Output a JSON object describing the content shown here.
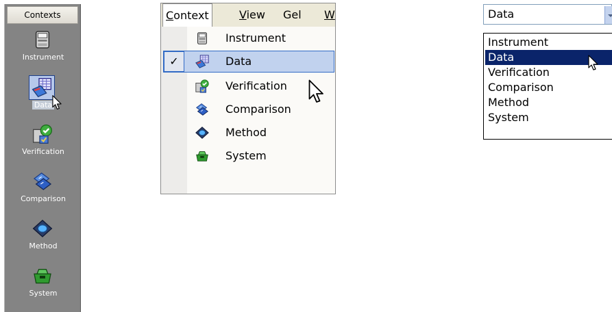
{
  "sidebar": {
    "header": "Contexts",
    "items": [
      {
        "label": "Instrument",
        "icon": "instrument-icon"
      },
      {
        "label": "Data",
        "icon": "data-icon",
        "selected": true
      },
      {
        "label": "Verification",
        "icon": "verification-icon"
      },
      {
        "label": "Comparison",
        "icon": "comparison-icon"
      },
      {
        "label": "Method",
        "icon": "method-icon"
      },
      {
        "label": "System",
        "icon": "system-icon"
      }
    ]
  },
  "menu": {
    "bar": [
      {
        "label": "Context",
        "mnemonic": "C",
        "rest": "ontext",
        "open": true
      },
      {
        "label": "View",
        "mnemonic": "V",
        "rest": "iew"
      },
      {
        "label": "Gel"
      },
      {
        "label": "W",
        "mnemonic": "W",
        "rest": ""
      }
    ],
    "items": [
      {
        "label": "Instrument",
        "icon": "instrument-icon"
      },
      {
        "label": "Data",
        "icon": "data-icon",
        "checked": true,
        "check_glyph": "✓"
      },
      {
        "label": "Verification",
        "icon": "verification-icon"
      },
      {
        "label": "Comparison",
        "icon": "comparison-icon"
      },
      {
        "label": "Method",
        "icon": "method-icon"
      },
      {
        "label": "System",
        "icon": "system-icon"
      }
    ]
  },
  "combo": {
    "value": "Data",
    "options": [
      "Instrument",
      "Data",
      "Verification",
      "Comparison",
      "Method",
      "System"
    ],
    "selected_option": "Data"
  },
  "colors": {
    "sidebar_bg": "#848484",
    "menu_highlight": "#c1d2ee",
    "menu_highlight_border": "#316ac5",
    "list_selected": "#0a246a"
  }
}
